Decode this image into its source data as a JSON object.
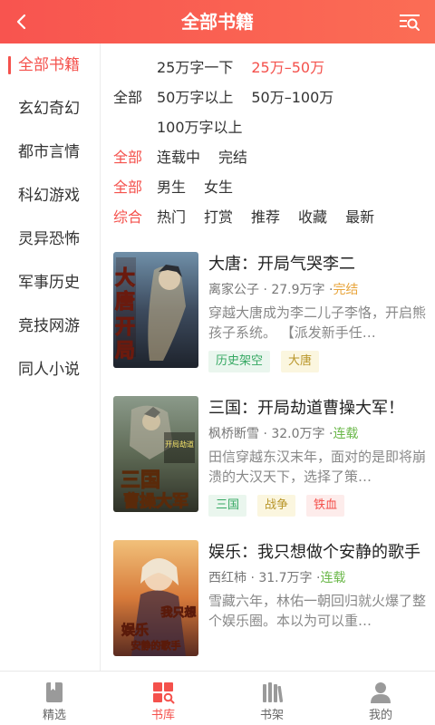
{
  "header": {
    "title": "全部书籍",
    "back_icon": "back-icon",
    "search_icon": "search-list-icon"
  },
  "sidebar": {
    "items": [
      {
        "label": "全部书籍",
        "active": true
      },
      {
        "label": "玄幻奇幻",
        "active": false
      },
      {
        "label": "都市言情",
        "active": false
      },
      {
        "label": "科幻游戏",
        "active": false
      },
      {
        "label": "灵异恐怖",
        "active": false
      },
      {
        "label": "军事历史",
        "active": false
      },
      {
        "label": "竞技网游",
        "active": false
      },
      {
        "label": "同人小说",
        "active": false
      }
    ]
  },
  "filters": {
    "words": {
      "lead": "全部",
      "options": [
        "25万字一下",
        "25万–50万",
        "50万字以上",
        "50万–100万",
        "100万字以上"
      ],
      "selected": 1
    },
    "status": {
      "lead": "全部",
      "options": [
        "连载中",
        "完结"
      ]
    },
    "gender": {
      "lead": "全部",
      "options": [
        "男生",
        "女生"
      ]
    },
    "sort": {
      "lead": "综合",
      "options": [
        "热门",
        "打赏",
        "推荐",
        "收藏",
        "最新"
      ]
    }
  },
  "books": [
    {
      "title": "大唐：开局气哭李二",
      "author": "离家公子",
      "words": "27.9万字",
      "status": "完结",
      "desc": "穿越大唐成为李二儿子李恪，开启熊孩子系统。 【派发新手任…",
      "tags": [
        "历史架空",
        "大唐"
      ],
      "cover_text": "大唐开局"
    },
    {
      "title": "三国：开局劫道曹操大军！",
      "author": "枫桥断雪",
      "words": "32.0万字",
      "status": "连载",
      "desc": "田信穿越东汉末年，面对的是即将崩溃的大汉天下，选择了策…",
      "tags": [
        "三国",
        "战争",
        "铁血"
      ],
      "cover_text": "三国曹操大军"
    },
    {
      "title": "娱乐：我只想做个安静的歌手",
      "author": "西红柿",
      "words": "31.7万字",
      "status": "连载",
      "desc": "雪藏六年，林佑一朝回归就火爆了整个娱乐圈。本以为可以重…",
      "tags": [],
      "cover_text": "娱乐我只想"
    }
  ],
  "meta_separator": "·",
  "tabbar": [
    {
      "label": "精选",
      "icon": "bookmark-book-icon",
      "active": false
    },
    {
      "label": "书库",
      "icon": "library-grid-icon",
      "active": true
    },
    {
      "label": "书架",
      "icon": "bookshelf-icon",
      "active": false
    },
    {
      "label": "我的",
      "icon": "user-icon",
      "active": false
    }
  ],
  "colors": {
    "accent": "#f4514c",
    "header_start": "#f8544f",
    "header_end": "#fb6d55"
  }
}
